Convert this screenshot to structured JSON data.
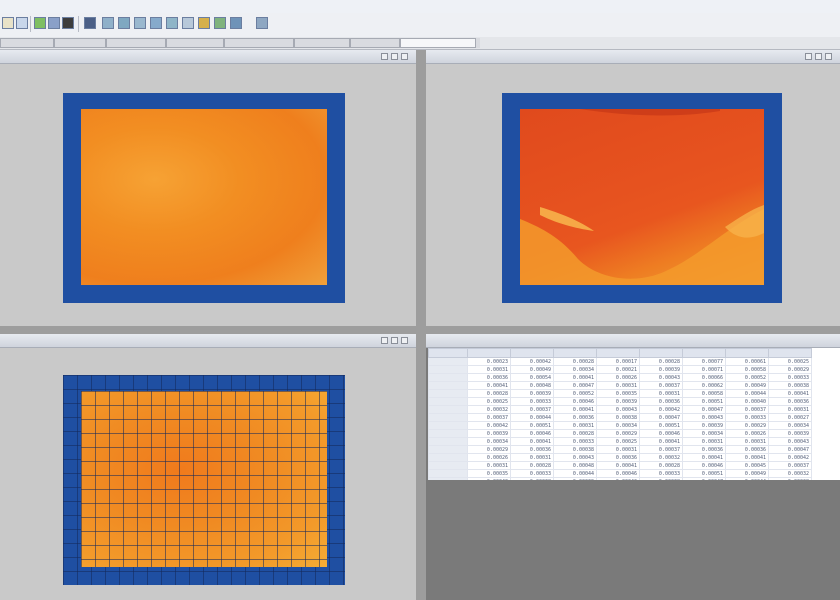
{
  "menubar": {
    "items": [
      "",
      "",
      "",
      "",
      "",
      ""
    ]
  },
  "toolbar": {
    "buttons": [
      {
        "icon": "new-file-icon",
        "color": "#e8e2c8"
      },
      {
        "icon": "save-icon",
        "color": "#c8d6ea"
      },
      {
        "icon": "run-icon",
        "color": "#7fbf63"
      },
      {
        "icon": "step-icon",
        "color": "#8aa0c8"
      },
      {
        "icon": "stop-icon",
        "color": "#3d3d3d"
      },
      {
        "icon": "calculator-icon",
        "color": "#4b5f86"
      },
      {
        "icon": "grid-icon",
        "color": "#8fb0c9"
      },
      {
        "icon": "mesh-icon",
        "color": "#7fa8c1"
      },
      {
        "icon": "layers-icon",
        "color": "#9ab8cf"
      },
      {
        "icon": "chart-icon",
        "color": "#86aacb"
      },
      {
        "icon": "table-icon",
        "color": "#8fb5c8"
      },
      {
        "icon": "document-icon",
        "color": "#b7c8d9"
      },
      {
        "icon": "palette-icon",
        "color": "#d6b04a"
      },
      {
        "icon": "image-icon",
        "color": "#7fb37e"
      },
      {
        "icon": "export-icon",
        "color": "#6f93b8"
      },
      {
        "icon": "settings-icon",
        "color": "#8ea7c2"
      }
    ]
  },
  "tabs": [
    "",
    "",
    "",
    "",
    "",
    "",
    "",
    "",
    "",
    ""
  ],
  "panes": {
    "top_left": {
      "title": ""
    },
    "top_right": {
      "title": ""
    },
    "bottom_left": {
      "title": ""
    },
    "bottom_right": {
      "title": ""
    }
  },
  "colors": {
    "frame_blue": "#1f4fa2",
    "heat_orange": "#f08a1c",
    "heat_red": "#e24a1f",
    "heat_yellow": "#f5b43a"
  },
  "table": {
    "headers": [
      "",
      "",
      "",
      "",
      "",
      "",
      "",
      "",
      ""
    ],
    "rows": [
      [
        "",
        "0.00023",
        "0.00042",
        "0.00028",
        "0.00017",
        "0.00028",
        "0.00077",
        "0.00061",
        "0.00025"
      ],
      [
        "",
        "0.00031",
        "0.00049",
        "0.00034",
        "0.00021",
        "0.00039",
        "0.00071",
        "0.00058",
        "0.00029"
      ],
      [
        "",
        "0.00036",
        "0.00054",
        "0.00041",
        "0.00026",
        "0.00043",
        "0.00066",
        "0.00052",
        "0.00033"
      ],
      [
        "",
        "0.00041",
        "0.00048",
        "0.00047",
        "0.00031",
        "0.00037",
        "0.00062",
        "0.00049",
        "0.00038"
      ],
      [
        "",
        "0.00028",
        "0.00039",
        "0.00052",
        "0.00035",
        "0.00031",
        "0.00058",
        "0.00044",
        "0.00041"
      ],
      [
        "",
        "0.00025",
        "0.00033",
        "0.00046",
        "0.00039",
        "0.00036",
        "0.00051",
        "0.00040",
        "0.00036"
      ],
      [
        "",
        "0.00032",
        "0.00037",
        "0.00041",
        "0.00043",
        "0.00042",
        "0.00047",
        "0.00037",
        "0.00031"
      ],
      [
        "",
        "0.00037",
        "0.00044",
        "0.00036",
        "0.00038",
        "0.00047",
        "0.00043",
        "0.00033",
        "0.00027"
      ],
      [
        "",
        "0.00042",
        "0.00051",
        "0.00031",
        "0.00034",
        "0.00051",
        "0.00039",
        "0.00029",
        "0.00034"
      ],
      [
        "",
        "0.00039",
        "0.00046",
        "0.00028",
        "0.00029",
        "0.00046",
        "0.00034",
        "0.00026",
        "0.00039"
      ],
      [
        "",
        "0.00034",
        "0.00041",
        "0.00033",
        "0.00025",
        "0.00041",
        "0.00031",
        "0.00031",
        "0.00043"
      ],
      [
        "",
        "0.00029",
        "0.00036",
        "0.00038",
        "0.00031",
        "0.00037",
        "0.00036",
        "0.00036",
        "0.00047"
      ],
      [
        "",
        "0.00026",
        "0.00031",
        "0.00043",
        "0.00036",
        "0.00032",
        "0.00041",
        "0.00041",
        "0.00042"
      ],
      [
        "",
        "0.00031",
        "0.00028",
        "0.00048",
        "0.00041",
        "0.00028",
        "0.00046",
        "0.00045",
        "0.00037"
      ],
      [
        "",
        "0.00035",
        "0.00033",
        "0.00044",
        "0.00046",
        "0.00033",
        "0.00051",
        "0.00049",
        "0.00032"
      ],
      [
        "",
        "0.00040",
        "0.00038",
        "0.00039",
        "0.00042",
        "0.00038",
        "0.00047",
        "0.00044",
        "0.00028"
      ]
    ]
  }
}
